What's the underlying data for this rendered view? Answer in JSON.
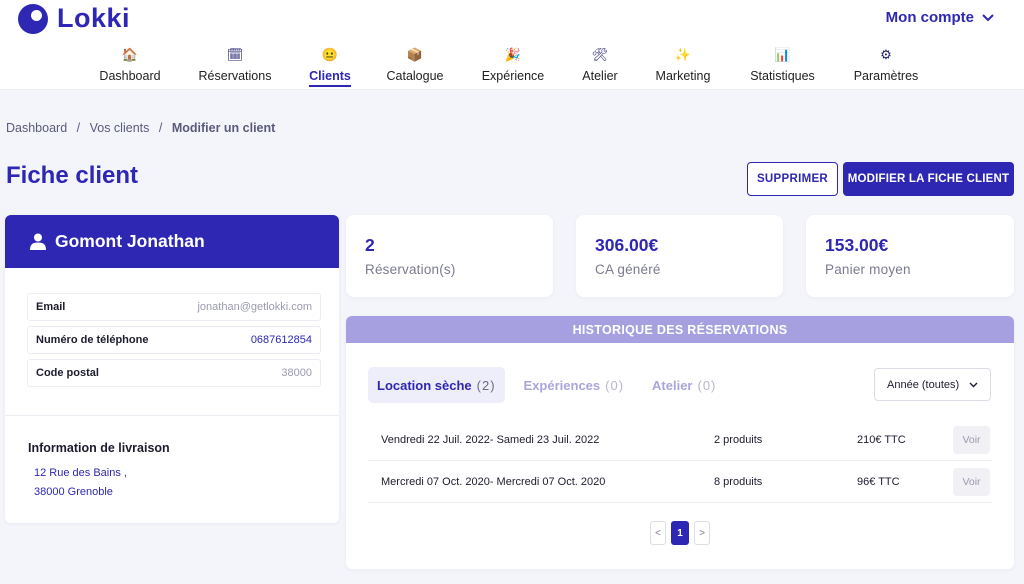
{
  "brand": {
    "name": "Lokki",
    "color": "#2e27b3"
  },
  "account": {
    "label": "Mon compte"
  },
  "nav": [
    {
      "label": "Dashboard",
      "icon": "house-icon"
    },
    {
      "label": "Réservations",
      "icon": "calendar-icon"
    },
    {
      "label": "Clients",
      "icon": "smiley-icon",
      "active": true
    },
    {
      "label": "Catalogue",
      "icon": "package-icon"
    },
    {
      "label": "Expérience",
      "icon": "party-popper-icon"
    },
    {
      "label": "Atelier",
      "icon": "tools-icon"
    },
    {
      "label": "Marketing",
      "icon": "sparkles-icon"
    },
    {
      "label": "Statistiques",
      "icon": "bar-chart-icon"
    },
    {
      "label": "Paramètres",
      "icon": "gear-icon"
    }
  ],
  "breadcrumb": {
    "items": [
      "Dashboard",
      "Vos clients"
    ],
    "current": "Modifier un client",
    "separator": "/"
  },
  "page": {
    "title": "Fiche client"
  },
  "actions": {
    "delete_label": "SUPPRIMER",
    "edit_label": "MODIFIER LA FICHE CLIENT"
  },
  "client": {
    "name": "Gomont Jonathan",
    "fields": [
      {
        "label": "Email",
        "value": "jonathan@getlokki.com"
      },
      {
        "label": "Numéro de téléphone",
        "value": "0687612854"
      },
      {
        "label": "Code postal",
        "value": "38000"
      }
    ],
    "shipping": {
      "title": "Information de livraison",
      "line1": "12 Rue des Bains ,",
      "line2": "38000 Grenoble"
    }
  },
  "stats": [
    {
      "value": "2",
      "label": "Réservation(s)"
    },
    {
      "value": "306.00€",
      "label": "CA généré"
    },
    {
      "value": "153.00€",
      "label": "Panier moyen"
    }
  ],
  "history": {
    "title": "HISTORIQUE DES RÉSERVATIONS",
    "tabs": [
      {
        "label": "Location sèche",
        "count": "(2)",
        "active": true
      },
      {
        "label": "Expériences",
        "count": "(0)"
      },
      {
        "label": "Atelier",
        "count": "(0)"
      }
    ],
    "year_filter": "Année (toutes)",
    "rows": [
      {
        "dates": "Vendredi 22 Juil. 2022- Samedi 23 Juil. 2022",
        "products": "2 produits",
        "price": "210€ TTC",
        "action": "Voir"
      },
      {
        "dates": "Mercredi 07 Oct. 2020- Mercredi 07 Oct. 2020",
        "products": "8 produits",
        "price": "96€ TTC",
        "action": "Voir"
      }
    ],
    "pagination": {
      "prev": "<",
      "current": "1",
      "next": ">"
    }
  }
}
